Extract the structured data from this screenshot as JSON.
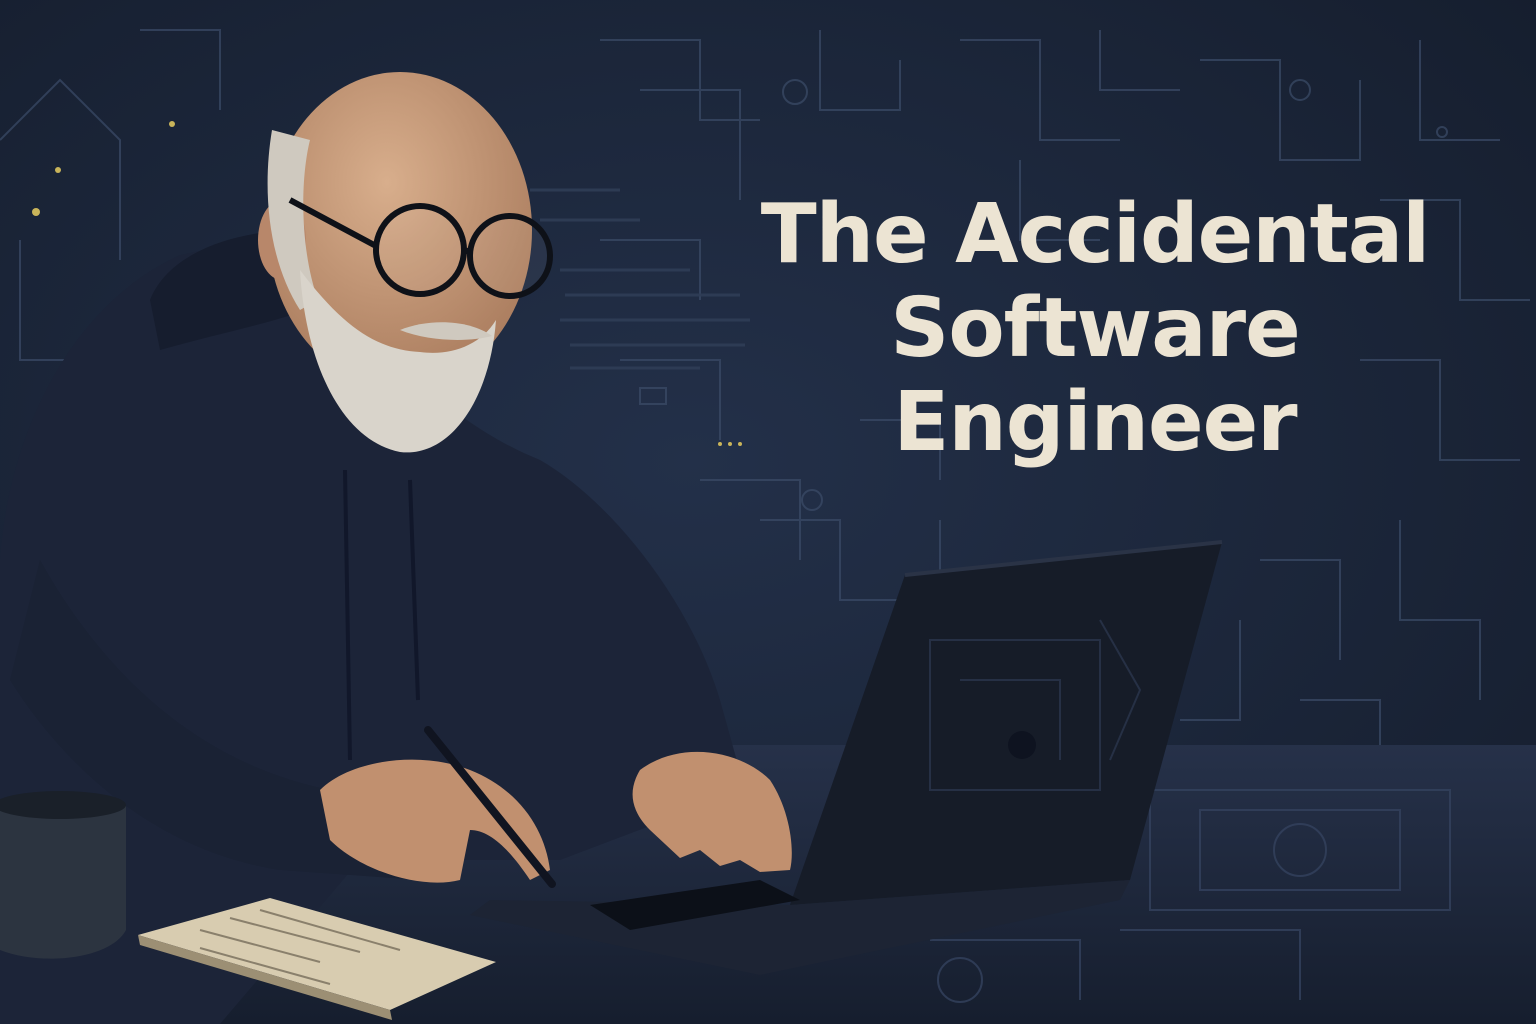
{
  "title": {
    "lines": [
      "The Accidental",
      "Software",
      "Engineer"
    ]
  },
  "colors": {
    "background": "#1a2436",
    "circuit_lines": "#3a4a66",
    "title_text": "#ece4d3",
    "hoodie": "#1c2438",
    "skin": "#c79a7a",
    "beard": "#d9d4cb",
    "laptop": "#161c28",
    "desk": "#202a3e",
    "mug": "#2c3440",
    "notebook": "#d8ccb0",
    "accent_dots": "#c9b45a"
  },
  "scene_elements": [
    "circuit-background",
    "man",
    "eyeglasses",
    "laptop",
    "keyboard",
    "coffee-mug",
    "notebook",
    "pen",
    "desk"
  ]
}
